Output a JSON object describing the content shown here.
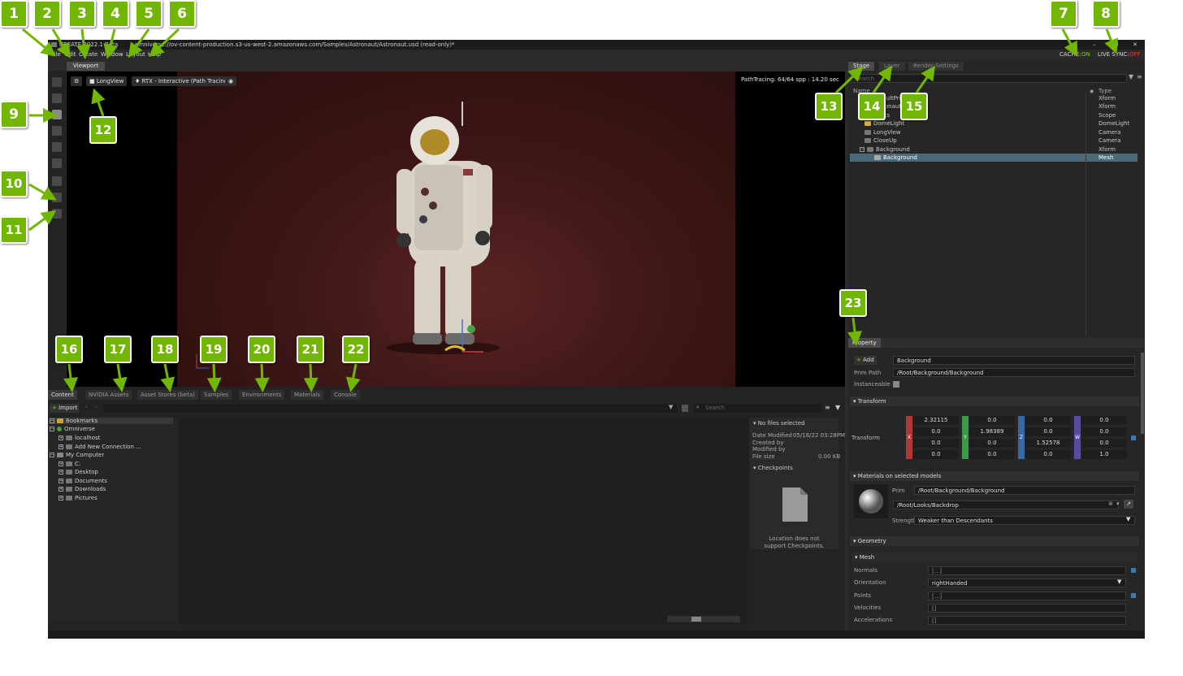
{
  "title_bar": {
    "app_name": "CREATE 2022.1 Beta",
    "file_path": "omniverse://ov-content-production.s3-us-west-2.amazonaws.com/Samples/Astronaut/Astronaut.usd (read-only)*",
    "min_symbol": "–",
    "max_symbol": "❐",
    "close_symbol": "✕"
  },
  "menu": [
    "File",
    "Edit",
    "Create",
    "Window",
    "Layout",
    "Help"
  ],
  "status_indicators": {
    "cache_label": "CACHE:",
    "cache_value": "ON",
    "live_sync_label": "LIVE SYNC:",
    "live_sync_value": "OFF"
  },
  "viewport": {
    "tab_label": "Viewport",
    "camera_button": "LongView",
    "render_mode_button": "RTX - Interactive (Path Tracing)",
    "stats": "PathTracing: 64/64 spp : 14.20 sec"
  },
  "stage_panel": {
    "tabs": [
      "Stage",
      "Layer",
      "Render Settings"
    ],
    "search_placeholder": "Search",
    "col_name": "Name",
    "col_type": "Type",
    "rows": [
      {
        "name": "defaultPrim",
        "type": "Xform"
      },
      {
        "name": "Astronaut",
        "type": "Xform"
      },
      {
        "name": "Looks",
        "type": "Scope"
      },
      {
        "name": "DomeLight",
        "type": "DomeLight"
      },
      {
        "name": "LongView",
        "type": "Camera"
      },
      {
        "name": "CloseUp",
        "type": "Camera"
      },
      {
        "name": "Background",
        "type": "Xform"
      },
      {
        "name": "Background",
        "type": "Mesh"
      }
    ]
  },
  "property_panel": {
    "tab_label": "Property",
    "add_button": "Add",
    "prim_name": "Background",
    "prim_path_label": "Prim Path",
    "prim_path": "/Root/Background/Background",
    "instanceable_label": "Instanceable",
    "transform_section": "Transform",
    "transform_label": "Transform",
    "axes": [
      "X",
      "Y",
      "Z",
      "W"
    ],
    "matrix": [
      [
        "2.32115",
        "0.0",
        "0.0",
        "0.0"
      ],
      [
        "0.0",
        "1.98389",
        "0.0",
        "0.0"
      ],
      [
        "0.0",
        "0.0",
        "1.52578",
        "0.0"
      ],
      [
        "0.0",
        "0.0",
        "0.0",
        "1.0"
      ]
    ],
    "materials_section": "Materials on selected models",
    "prim_label": "Prim",
    "material_prim": "/Root/Background/Background",
    "material_path": "/Root/Looks/Backdrop",
    "strength_label": "Strength",
    "strength_value": "Weaker than Descendants",
    "geometry_section": "Geometry",
    "mesh_section": "Mesh",
    "geometry_rows": [
      {
        "label": "Normals",
        "value": "[...]"
      },
      {
        "label": "Orientation",
        "value": "rightHanded"
      },
      {
        "label": "Points",
        "value": "[...]"
      },
      {
        "label": "Velocities",
        "value": "[]"
      },
      {
        "label": "Accelerations",
        "value": "[]"
      }
    ]
  },
  "content_browser": {
    "tabs": [
      "Content",
      "NVIDIA Assets",
      "Asset Stores (beta)",
      "Samples",
      "Environments",
      "Materials",
      "Console"
    ],
    "import_button": "Import",
    "search_placeholder": "Search",
    "tree": [
      {
        "label": "Bookmarks",
        "level": 0
      },
      {
        "label": "Omniverse",
        "level": 0
      },
      {
        "label": "localhost",
        "level": 1
      },
      {
        "label": "Add New Connection ...",
        "level": 1
      },
      {
        "label": "My Computer",
        "level": 0
      },
      {
        "label": "C:",
        "level": 1
      },
      {
        "label": "Desktop",
        "level": 1
      },
      {
        "label": "Documents",
        "level": 1
      },
      {
        "label": "Downloads",
        "level": 1
      },
      {
        "label": "Pictures",
        "level": 1
      }
    ],
    "details": {
      "no_files": "No files selected",
      "date_modified_label": "Date Modified",
      "date_modified_value": "05/16/22 03:28PM",
      "created_by_label": "Created by",
      "modified_by_label": "Modified by",
      "file_size_label": "File size",
      "file_size_value": "0.00 KB",
      "checkpoints_label": "Checkpoints",
      "checkpoints_msg_1": "Location does not",
      "checkpoints_msg_2": "support Checkpoints."
    }
  },
  "callouts": [
    "1",
    "2",
    "3",
    "4",
    "5",
    "6",
    "7",
    "8",
    "9",
    "10",
    "11",
    "12",
    "13",
    "14",
    "15",
    "16",
    "17",
    "18",
    "19",
    "20",
    "21",
    "22",
    "23"
  ],
  "colors": {
    "callout": "#71b600",
    "cache_on": "#7bd400",
    "live_sync_off": "#e04040",
    "accent_selected": "#4a6a7a"
  }
}
